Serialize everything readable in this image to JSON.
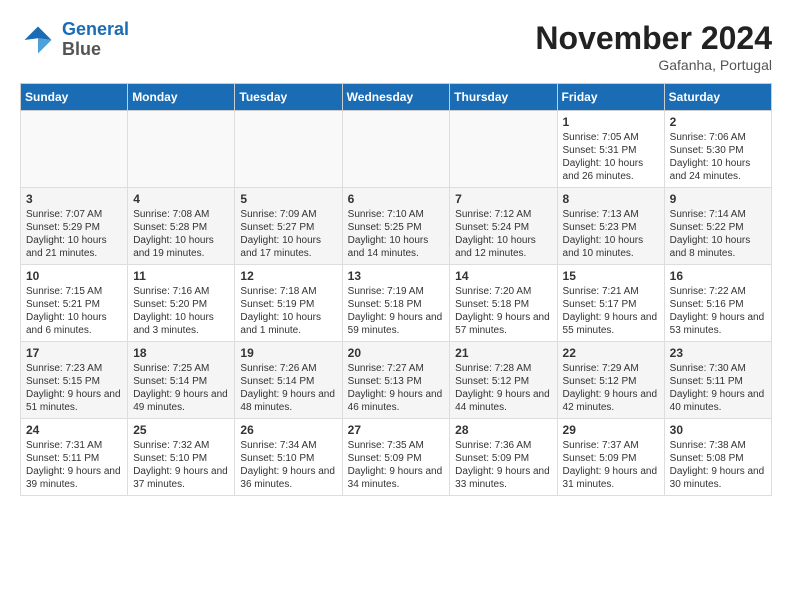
{
  "header": {
    "logo_line1": "General",
    "logo_line2": "Blue",
    "month": "November 2024",
    "location": "Gafanha, Portugal"
  },
  "weekdays": [
    "Sunday",
    "Monday",
    "Tuesday",
    "Wednesday",
    "Thursday",
    "Friday",
    "Saturday"
  ],
  "weeks": [
    [
      {
        "day": "",
        "info": ""
      },
      {
        "day": "",
        "info": ""
      },
      {
        "day": "",
        "info": ""
      },
      {
        "day": "",
        "info": ""
      },
      {
        "day": "",
        "info": ""
      },
      {
        "day": "1",
        "info": "Sunrise: 7:05 AM\nSunset: 5:31 PM\nDaylight: 10 hours and 26 minutes."
      },
      {
        "day": "2",
        "info": "Sunrise: 7:06 AM\nSunset: 5:30 PM\nDaylight: 10 hours and 24 minutes."
      }
    ],
    [
      {
        "day": "3",
        "info": "Sunrise: 7:07 AM\nSunset: 5:29 PM\nDaylight: 10 hours and 21 minutes."
      },
      {
        "day": "4",
        "info": "Sunrise: 7:08 AM\nSunset: 5:28 PM\nDaylight: 10 hours and 19 minutes."
      },
      {
        "day": "5",
        "info": "Sunrise: 7:09 AM\nSunset: 5:27 PM\nDaylight: 10 hours and 17 minutes."
      },
      {
        "day": "6",
        "info": "Sunrise: 7:10 AM\nSunset: 5:25 PM\nDaylight: 10 hours and 14 minutes."
      },
      {
        "day": "7",
        "info": "Sunrise: 7:12 AM\nSunset: 5:24 PM\nDaylight: 10 hours and 12 minutes."
      },
      {
        "day": "8",
        "info": "Sunrise: 7:13 AM\nSunset: 5:23 PM\nDaylight: 10 hours and 10 minutes."
      },
      {
        "day": "9",
        "info": "Sunrise: 7:14 AM\nSunset: 5:22 PM\nDaylight: 10 hours and 8 minutes."
      }
    ],
    [
      {
        "day": "10",
        "info": "Sunrise: 7:15 AM\nSunset: 5:21 PM\nDaylight: 10 hours and 6 minutes."
      },
      {
        "day": "11",
        "info": "Sunrise: 7:16 AM\nSunset: 5:20 PM\nDaylight: 10 hours and 3 minutes."
      },
      {
        "day": "12",
        "info": "Sunrise: 7:18 AM\nSunset: 5:19 PM\nDaylight: 10 hours and 1 minute."
      },
      {
        "day": "13",
        "info": "Sunrise: 7:19 AM\nSunset: 5:18 PM\nDaylight: 9 hours and 59 minutes."
      },
      {
        "day": "14",
        "info": "Sunrise: 7:20 AM\nSunset: 5:18 PM\nDaylight: 9 hours and 57 minutes."
      },
      {
        "day": "15",
        "info": "Sunrise: 7:21 AM\nSunset: 5:17 PM\nDaylight: 9 hours and 55 minutes."
      },
      {
        "day": "16",
        "info": "Sunrise: 7:22 AM\nSunset: 5:16 PM\nDaylight: 9 hours and 53 minutes."
      }
    ],
    [
      {
        "day": "17",
        "info": "Sunrise: 7:23 AM\nSunset: 5:15 PM\nDaylight: 9 hours and 51 minutes."
      },
      {
        "day": "18",
        "info": "Sunrise: 7:25 AM\nSunset: 5:14 PM\nDaylight: 9 hours and 49 minutes."
      },
      {
        "day": "19",
        "info": "Sunrise: 7:26 AM\nSunset: 5:14 PM\nDaylight: 9 hours and 48 minutes."
      },
      {
        "day": "20",
        "info": "Sunrise: 7:27 AM\nSunset: 5:13 PM\nDaylight: 9 hours and 46 minutes."
      },
      {
        "day": "21",
        "info": "Sunrise: 7:28 AM\nSunset: 5:12 PM\nDaylight: 9 hours and 44 minutes."
      },
      {
        "day": "22",
        "info": "Sunrise: 7:29 AM\nSunset: 5:12 PM\nDaylight: 9 hours and 42 minutes."
      },
      {
        "day": "23",
        "info": "Sunrise: 7:30 AM\nSunset: 5:11 PM\nDaylight: 9 hours and 40 minutes."
      }
    ],
    [
      {
        "day": "24",
        "info": "Sunrise: 7:31 AM\nSunset: 5:11 PM\nDaylight: 9 hours and 39 minutes."
      },
      {
        "day": "25",
        "info": "Sunrise: 7:32 AM\nSunset: 5:10 PM\nDaylight: 9 hours and 37 minutes."
      },
      {
        "day": "26",
        "info": "Sunrise: 7:34 AM\nSunset: 5:10 PM\nDaylight: 9 hours and 36 minutes."
      },
      {
        "day": "27",
        "info": "Sunrise: 7:35 AM\nSunset: 5:09 PM\nDaylight: 9 hours and 34 minutes."
      },
      {
        "day": "28",
        "info": "Sunrise: 7:36 AM\nSunset: 5:09 PM\nDaylight: 9 hours and 33 minutes."
      },
      {
        "day": "29",
        "info": "Sunrise: 7:37 AM\nSunset: 5:09 PM\nDaylight: 9 hours and 31 minutes."
      },
      {
        "day": "30",
        "info": "Sunrise: 7:38 AM\nSunset: 5:08 PM\nDaylight: 9 hours and 30 minutes."
      }
    ]
  ]
}
